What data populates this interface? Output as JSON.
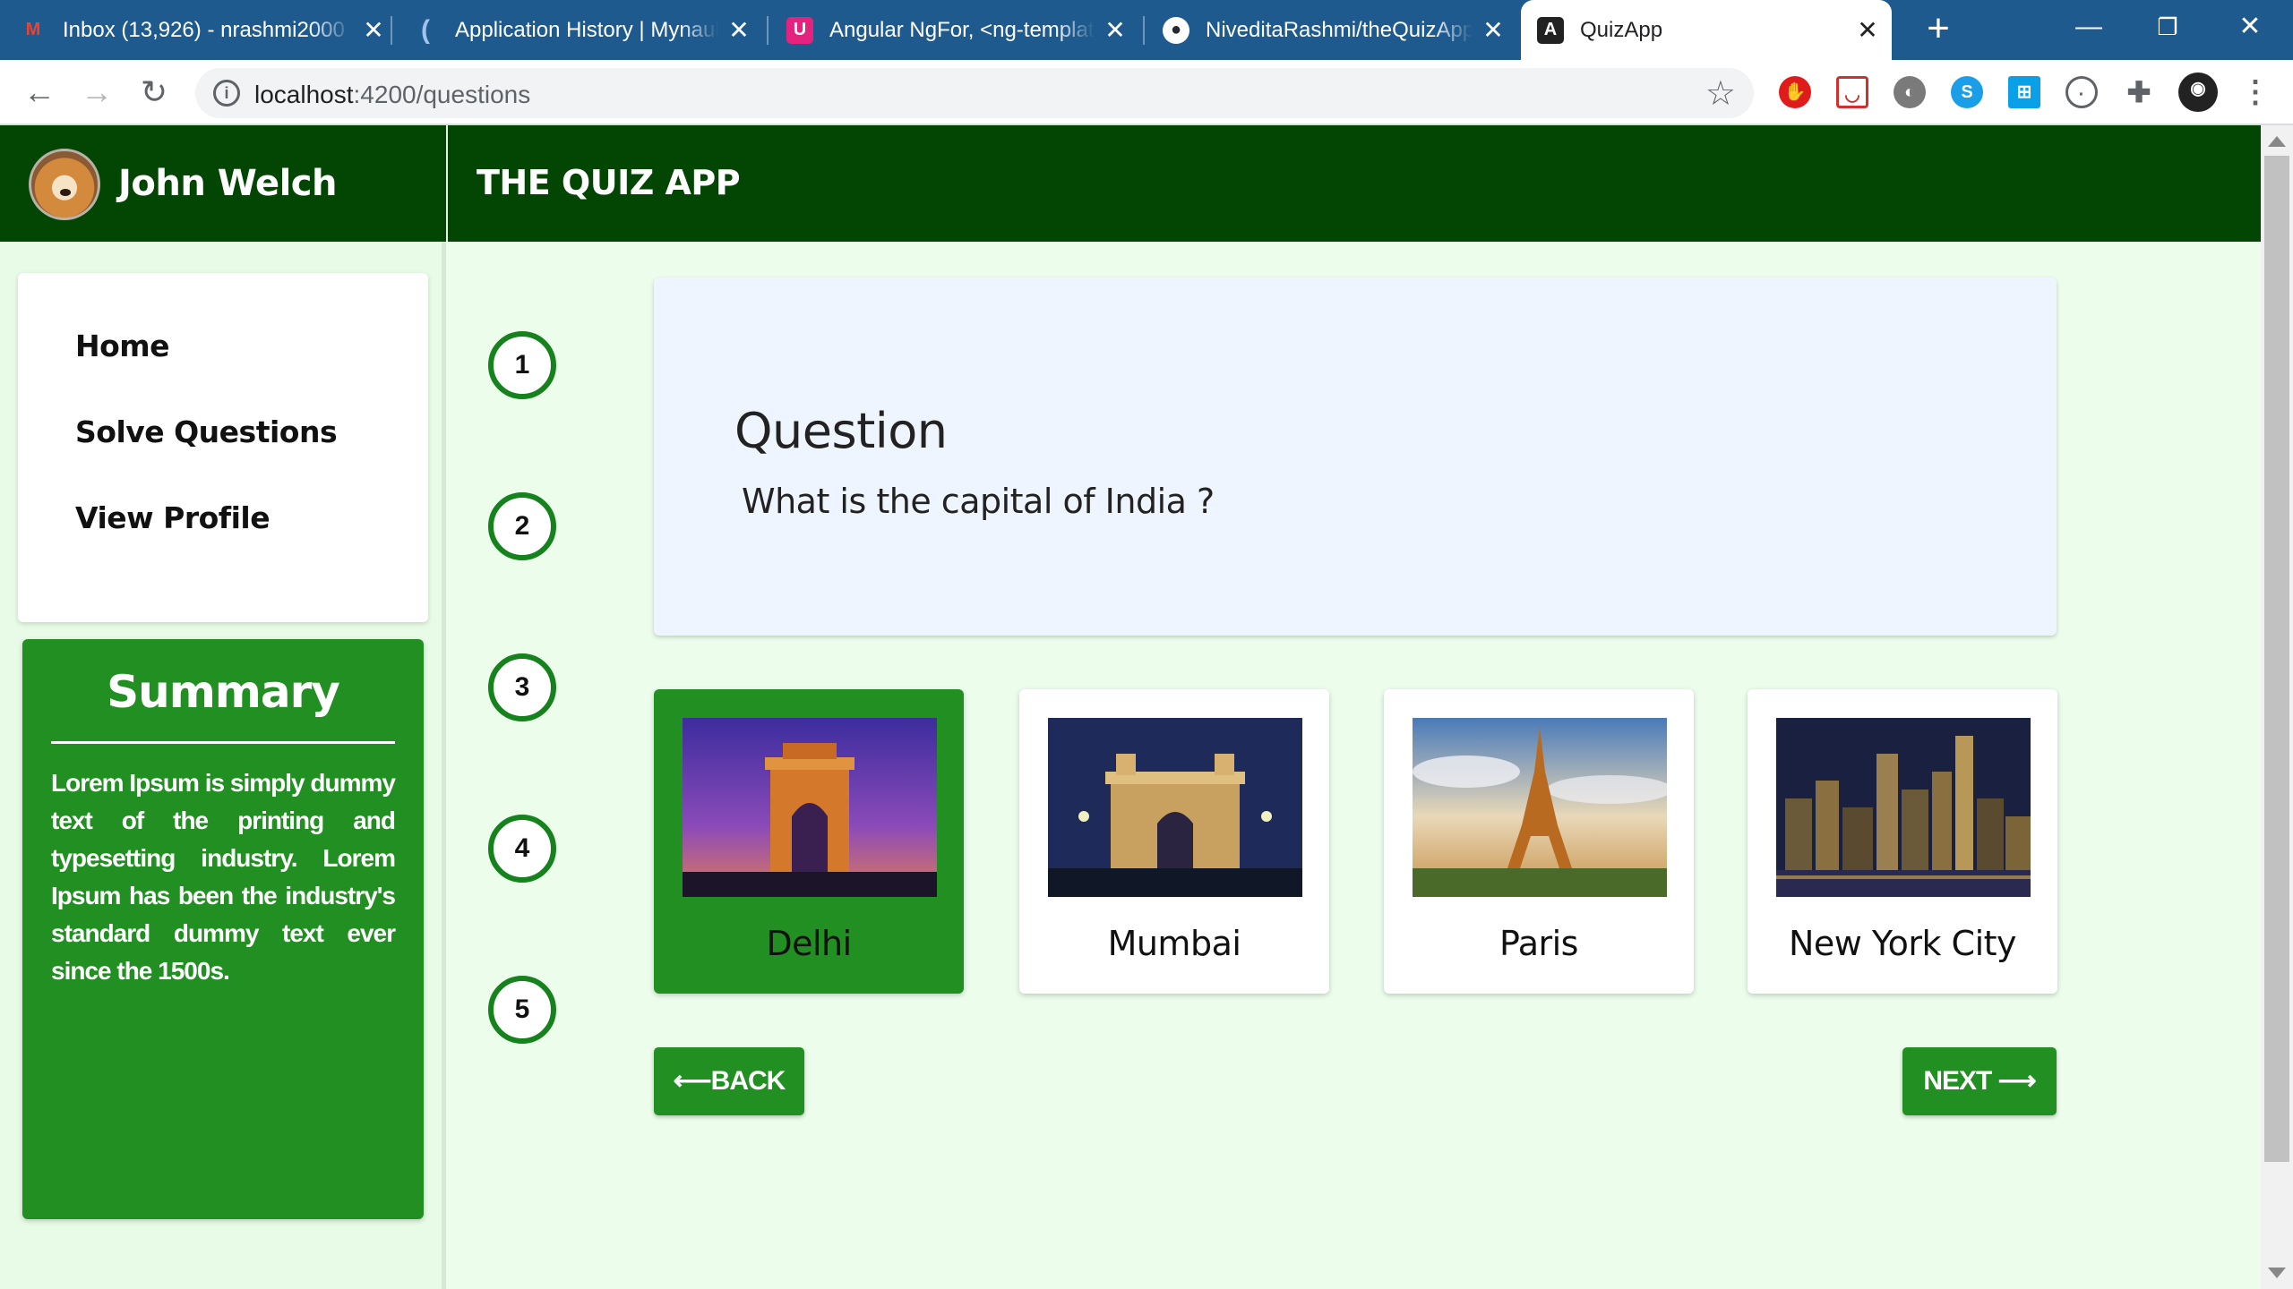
{
  "browser": {
    "tabs": [
      {
        "title": "Inbox (13,926) - nrashmi2000",
        "icon": "gmail-icon",
        "color": "#ea4335"
      },
      {
        "title": "Application History | Mynaukri",
        "icon": "mynaukri-icon",
        "color": "#1f5a8e"
      },
      {
        "title": "Angular NgFor, <ng-template>",
        "icon": "ultimate-icon",
        "color": "#e5237e"
      },
      {
        "title": "NiveditaRashmi/theQuizApp",
        "icon": "github-icon",
        "color": "#24292e"
      },
      {
        "title": "QuizApp",
        "icon": "angular-icon",
        "color": "#222222"
      }
    ],
    "url_host": "localhost",
    "url_path": ":4200/questions"
  },
  "user": {
    "name": "John Welch"
  },
  "app": {
    "title": "THE QUIZ APP"
  },
  "nav": [
    "Home",
    "Solve Questions",
    "View Profile"
  ],
  "summary": {
    "title": "Summary",
    "text": "Lorem Ipsum is simply dummy text of the printing and typesetting industry. Lorem Ipsum has been the industry's standard dummy text ever since the 1500s."
  },
  "question_numbers": [
    "1",
    "2",
    "3",
    "4",
    "5"
  ],
  "question": {
    "label": "Question",
    "text": "What is the capital of India ?"
  },
  "options": [
    {
      "label": "Delhi",
      "selected": true
    },
    {
      "label": "Mumbai",
      "selected": false
    },
    {
      "label": "Paris",
      "selected": false
    },
    {
      "label": "New York City",
      "selected": false
    }
  ],
  "buttons": {
    "back": "⟵BACK",
    "next": "NEXT ⟶"
  },
  "colors": {
    "header": "#034502",
    "accent": "#218f21",
    "page_bg": "#edfdec",
    "question_bg": "#eef5fe"
  }
}
